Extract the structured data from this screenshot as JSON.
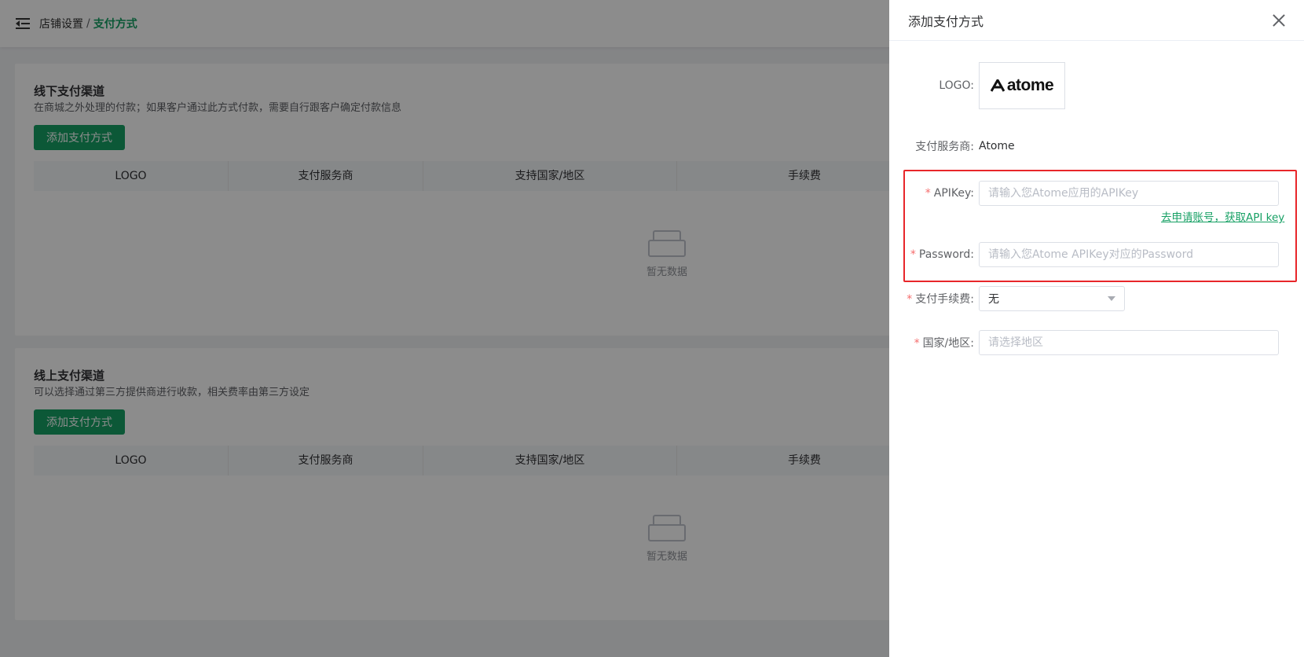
{
  "header": {
    "breadcrumb_1": "店铺设置",
    "breadcrumb_sep": "/",
    "breadcrumb_2": "支付方式"
  },
  "offline": {
    "title": "线下支付渠道",
    "desc": "在商城之外处理的付款；如果客户通过此方式付款，需要自行跟客户确定付款信息",
    "add_label": "添加支付方式",
    "columns": [
      "LOGO",
      "支付服务商",
      "支持国家/地区",
      "手续费"
    ],
    "empty_text": "暂无数据"
  },
  "online": {
    "title": "线上支付渠道",
    "desc": "可以选择通过第三方提供商进行收款，相关费率由第三方设定",
    "add_label": "添加支付方式",
    "columns": [
      "LOGO",
      "支付服务商",
      "支持国家/地区",
      "手续费"
    ],
    "empty_text": "暂无数据"
  },
  "drawer": {
    "title": "添加支付方式",
    "logo_label": "LOGO:",
    "logo_text": "atome",
    "provider_label": "支付服务商:",
    "provider_value": "Atome",
    "apikey_label": "APIKey:",
    "apikey_placeholder": "请输入您Atome应用的APIKey",
    "apikey_link": "去申请账号，获取API key",
    "password_label": "Password:",
    "password_placeholder": "请输入您Atome APIKey对应的Password",
    "fee_label": "支付手续费:",
    "fee_value": "无",
    "region_label": "国家/地区:",
    "region_placeholder": "请选择地区",
    "required_mark": "*"
  },
  "colors": {
    "primary": "#16a064",
    "highlight": "#e8262a",
    "required": "#f56c6c"
  },
  "icons": {
    "menu": "menu-fold-icon",
    "close": "close-icon",
    "empty": "empty-inbox-icon",
    "caret": "chevron-down-icon"
  }
}
